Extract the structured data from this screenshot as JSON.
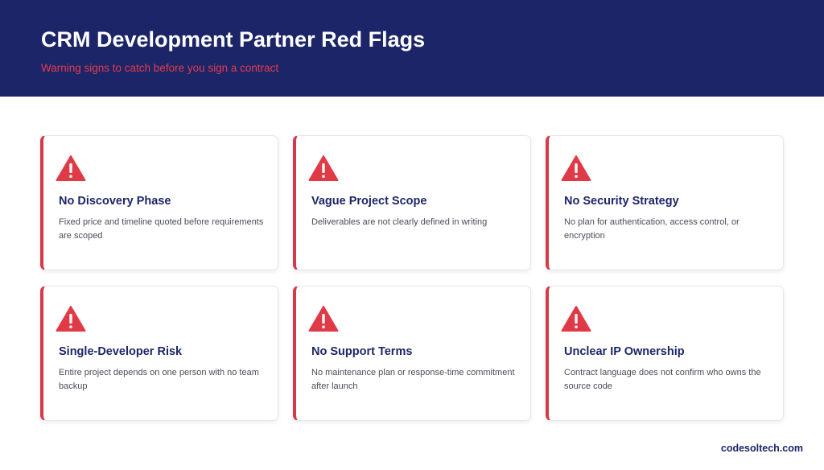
{
  "header": {
    "title": "CRM Development Partner Red Flags",
    "subtitle": "Warning signs to catch before you sign a contract"
  },
  "colors": {
    "header_bg": "#1d2569",
    "accent_red": "#d63a48",
    "title_navy": "#1d2569"
  },
  "cards": [
    {
      "icon": "warning-triangle-icon",
      "title": "No Discovery Phase",
      "description": "Fixed price and timeline quoted before requirements are scoped"
    },
    {
      "icon": "warning-triangle-icon",
      "title": "Vague Project Scope",
      "description": "Deliverables are not clearly defined in writing"
    },
    {
      "icon": "warning-triangle-icon",
      "title": "No Security Strategy",
      "description": "No plan for authentication, access control, or encryption"
    },
    {
      "icon": "warning-triangle-icon",
      "title": "Single-Developer Risk",
      "description": "Entire project depends on one person with no team backup"
    },
    {
      "icon": "warning-triangle-icon",
      "title": "No Support Terms",
      "description": "No maintenance plan or response-time commitment after launch"
    },
    {
      "icon": "warning-triangle-icon",
      "title": "Unclear IP Ownership",
      "description": "Contract language does not confirm who owns the source code"
    }
  ],
  "footer": {
    "brand": "codesoltech.com"
  }
}
